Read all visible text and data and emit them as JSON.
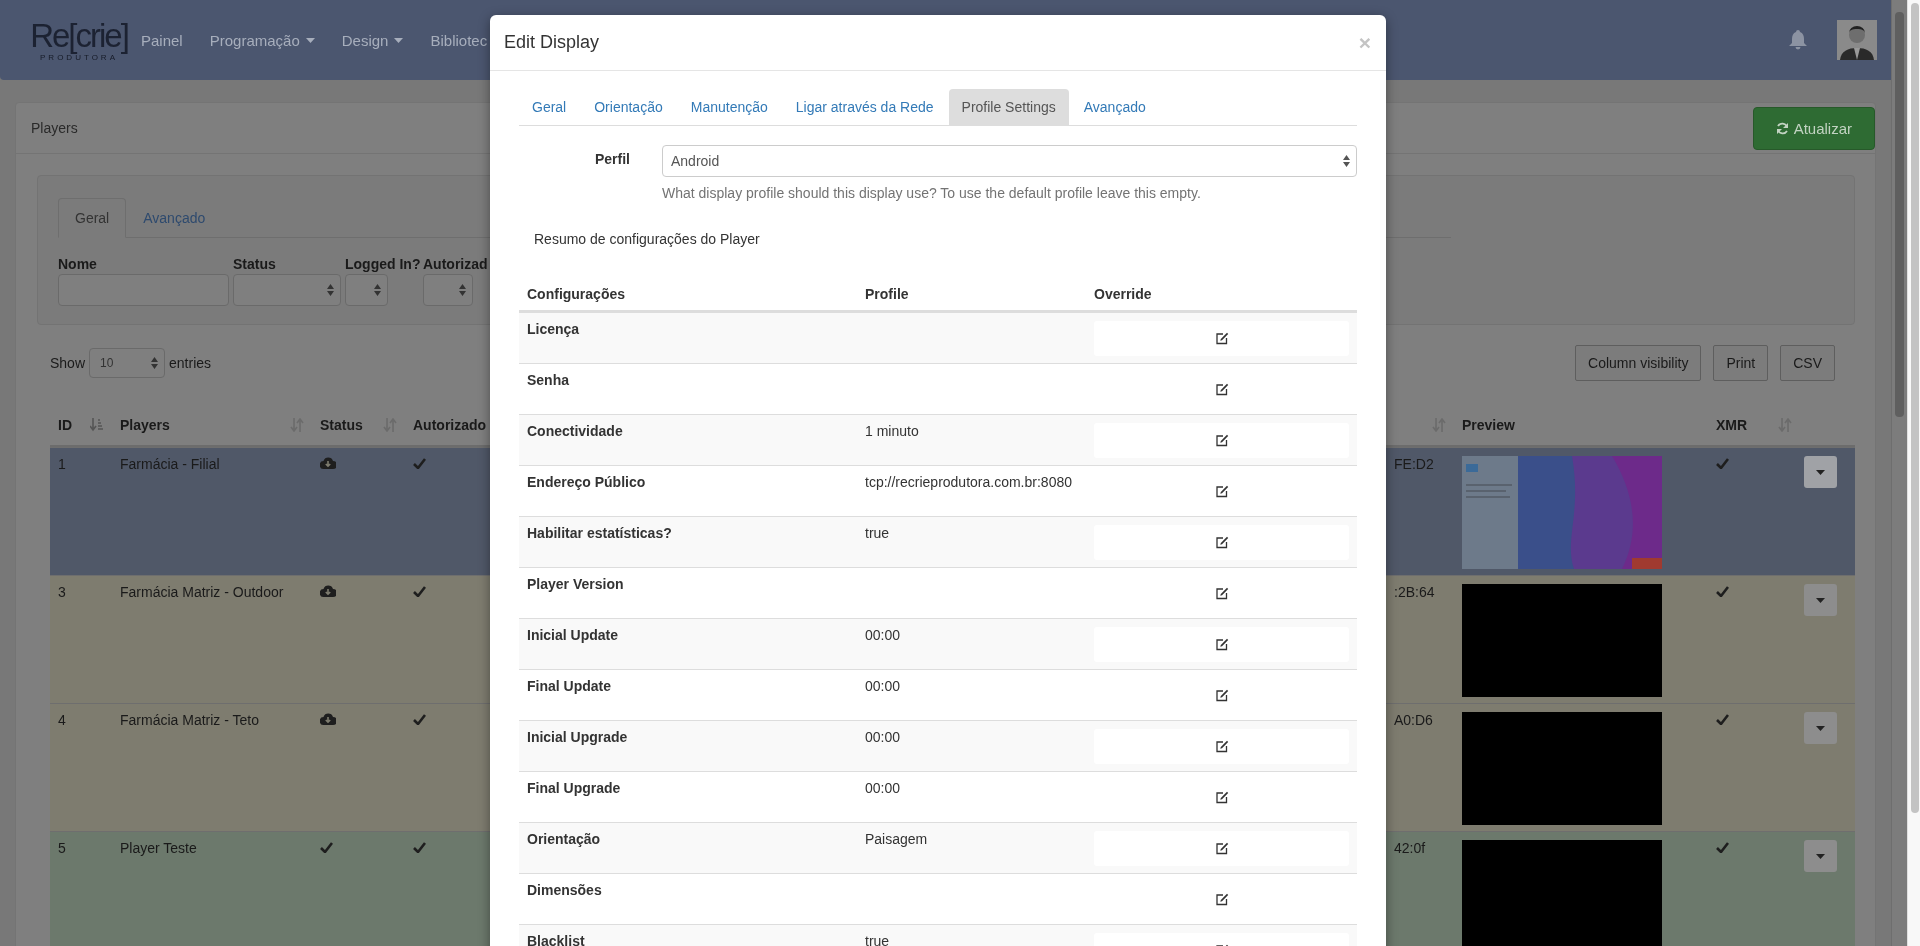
{
  "navbar": {
    "logo": {
      "wordmark": "Re[crie]",
      "tagline": "PRODUTORA"
    },
    "items": [
      {
        "label": "Painel",
        "dropdown": false
      },
      {
        "label": "Programação",
        "dropdown": true
      },
      {
        "label": "Design",
        "dropdown": true
      },
      {
        "label": "Bibliotec",
        "dropdown": false
      }
    ]
  },
  "page": {
    "title": "Players",
    "refresh_button": "Atualizar",
    "filter_tabs": [
      {
        "label": "Geral",
        "selected": true
      },
      {
        "label": "Avançado",
        "selected": false
      }
    ],
    "filters": [
      {
        "label": "Nome",
        "kind": "text"
      },
      {
        "label": "Status",
        "kind": "select"
      },
      {
        "label": "Logged In?",
        "kind": "select"
      },
      {
        "label": "Autorizad",
        "kind": "select"
      }
    ],
    "length": {
      "before": "Show",
      "value": "10",
      "after": "entries"
    },
    "buttons": [
      "Column visibility",
      "Print",
      "CSV"
    ],
    "table": {
      "columns": [
        {
          "label": "ID",
          "sortable": true,
          "sorted": true
        },
        {
          "label": "Players",
          "sortable": true,
          "sorted": false
        },
        {
          "label": "Status",
          "sortable": true,
          "sorted": false
        },
        {
          "label": "Autorizado",
          "sortable": false
        },
        {
          "sortable": true,
          "sorted": false
        },
        {
          "label": "Preview",
          "sortable": false
        },
        {
          "label": "XMR",
          "sortable": true,
          "sorted": false
        },
        {
          "sortable": false
        }
      ],
      "rows": [
        {
          "id": "1",
          "name": "Farmácia - Filial",
          "up_to_date": false,
          "authorized": true,
          "column_5": "FE:D2",
          "preview_blank": false,
          "xmr": true,
          "color": "#505868"
        },
        {
          "id": "3",
          "name": "Farmácia Matriz - Outdoor",
          "up_to_date": false,
          "authorized": true,
          "column_5": ":2B:64",
          "preview_blank": true,
          "xmr": true,
          "color": "#7e7c6f"
        },
        {
          "id": "4",
          "name": "Farmácia Matriz - Teto",
          "up_to_date": false,
          "authorized": true,
          "column_5": "A0:D6",
          "preview_blank": true,
          "xmr": true,
          "color": "#7e7c6f"
        },
        {
          "id": "5",
          "name": "Player Teste",
          "up_to_date": true,
          "authorized": true,
          "column_5": "42:0f",
          "preview_blank": true,
          "xmr": true,
          "color": "#6c796c"
        }
      ]
    }
  },
  "modal": {
    "title": "Edit Display",
    "close": "×",
    "tabs": [
      {
        "label": "Geral",
        "selected": false
      },
      {
        "label": "Orientação",
        "selected": false
      },
      {
        "label": "Manutenção",
        "selected": false
      },
      {
        "label": "Ligar através da Rede",
        "selected": false
      },
      {
        "label": "Profile Settings",
        "selected": true
      },
      {
        "label": "Avançado",
        "selected": false
      }
    ],
    "profile": {
      "label": "Perfil",
      "value": "Android",
      "help": "What display profile should this display use? To use the default profile leave this empty."
    },
    "summary_title": "Resumo de configurações do Player",
    "settings": {
      "columns": [
        "Configurações",
        "Profile",
        "Override"
      ],
      "rows": [
        {
          "name": "Licença"
        },
        {
          "name": "Senha"
        },
        {
          "name": "Conectividade",
          "profile": "1 minuto"
        },
        {
          "name": "Endereço Público",
          "profile": "tcp://recrieprodutora.com.br:8080"
        },
        {
          "name": "Habilitar estatísticas?",
          "profile": "true"
        },
        {
          "name": "Player Version"
        },
        {
          "name": "Inicial Update",
          "profile": "00:00"
        },
        {
          "name": "Final Update",
          "profile": "00:00"
        },
        {
          "name": "Inicial Upgrade",
          "profile": "00:00"
        },
        {
          "name": "Final Upgrade",
          "profile": "00:00"
        },
        {
          "name": "Orientação",
          "profile": "Paisagem"
        },
        {
          "name": "Dimensões"
        },
        {
          "name": "Blacklist",
          "profile": "true"
        }
      ]
    }
  }
}
